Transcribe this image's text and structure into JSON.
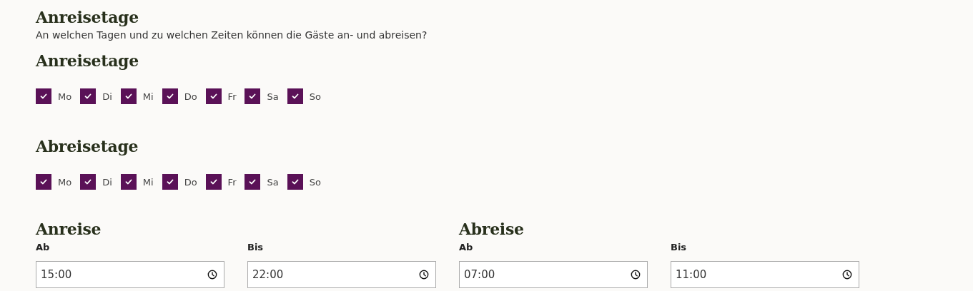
{
  "title": "Anreisetage",
  "subtitle": "An welchen Tagen und zu welchen Zeiten können die Gäste an- und abreisen?",
  "day_groups": [
    {
      "heading": "Anreisetage",
      "days": [
        {
          "label": "Mo",
          "checked": true
        },
        {
          "label": "Di",
          "checked": true
        },
        {
          "label": "Mi",
          "checked": true
        },
        {
          "label": "Do",
          "checked": true
        },
        {
          "label": "Fr",
          "checked": true
        },
        {
          "label": "Sa",
          "checked": true
        },
        {
          "label": "So",
          "checked": true
        }
      ]
    },
    {
      "heading": "Abreisetage",
      "days": [
        {
          "label": "Mo",
          "checked": true
        },
        {
          "label": "Di",
          "checked": true
        },
        {
          "label": "Mi",
          "checked": true
        },
        {
          "label": "Do",
          "checked": true
        },
        {
          "label": "Fr",
          "checked": true
        },
        {
          "label": "Sa",
          "checked": true
        },
        {
          "label": "So",
          "checked": true
        }
      ]
    }
  ],
  "time_groups": [
    {
      "heading": "Anreise",
      "fields": [
        {
          "label": "Ab",
          "value": "15:00"
        },
        {
          "label": "Bis",
          "value": "22:00"
        }
      ]
    },
    {
      "heading": "Abreise",
      "fields": [
        {
          "label": "Ab",
          "value": "07:00"
        },
        {
          "label": "Bis",
          "value": "11:00"
        }
      ]
    }
  ]
}
